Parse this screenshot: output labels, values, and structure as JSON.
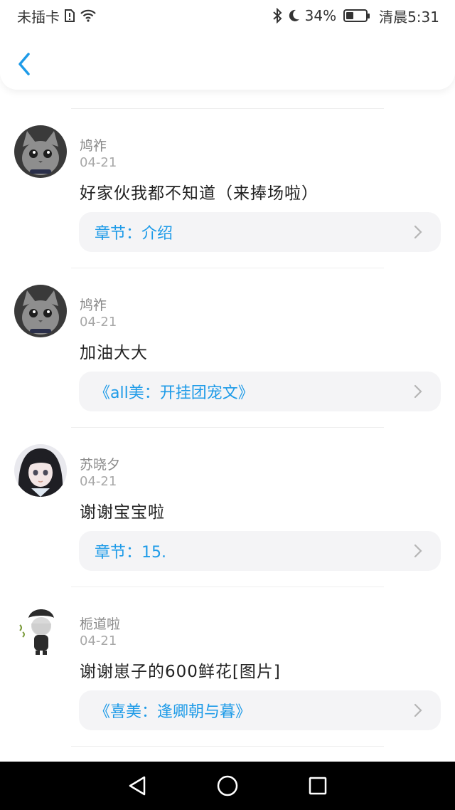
{
  "status_bar": {
    "carrier": "未插卡",
    "battery_percent": "34%",
    "battery_level": 0.34,
    "time": "清晨5:31"
  },
  "comments": [
    {
      "username": "鸠祚",
      "date": "04-21",
      "content": "好家伙我都不知道（来捧场啦）",
      "link": "章节：介绍",
      "avatar": "gray-cat-avatar"
    },
    {
      "username": "鸠祚",
      "date": "04-21",
      "content": "加油大大",
      "link": "《all美：开挂团宠文》",
      "avatar": "gray-cat-avatar"
    },
    {
      "username": "苏晓夕",
      "date": "04-21",
      "content": "谢谢宝宝啦",
      "link": "章节：15.",
      "avatar": "anime-girl-avatar"
    },
    {
      "username": "栀道啦",
      "date": "04-21",
      "content": "谢谢崽子的600鲜花[图片]",
      "link": "《喜美：逢卿朝与暮》",
      "avatar": "chibi-character-avatar"
    }
  ],
  "colors": {
    "accent": "#1e9be8",
    "link_bg": "#f4f4f6",
    "navbar_bg": "#000000"
  }
}
